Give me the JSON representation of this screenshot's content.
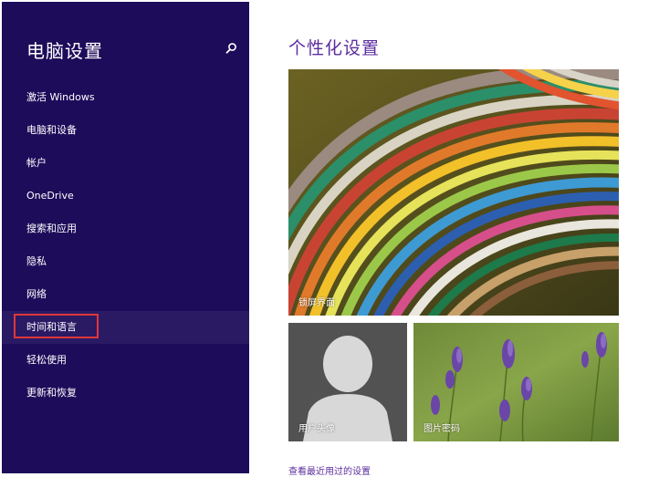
{
  "sidebar": {
    "title": "电脑设置",
    "search_icon": "search-icon",
    "items": [
      {
        "label": "激活 Windows"
      },
      {
        "label": "电脑和设备"
      },
      {
        "label": "帐户"
      },
      {
        "label": "OneDrive"
      },
      {
        "label": "搜索和应用"
      },
      {
        "label": "隐私"
      },
      {
        "label": "网络"
      },
      {
        "label": "时间和语言",
        "selected": true
      },
      {
        "label": "轻松使用"
      },
      {
        "label": "更新和恢复"
      }
    ]
  },
  "main": {
    "title": "个性化设置",
    "tiles": {
      "lock_screen": {
        "label": "锁屏界面"
      },
      "account_picture": {
        "label": "用户头像"
      },
      "picture_password": {
        "label": "图片密码"
      }
    },
    "recent_link": "查看最近用过的设置"
  },
  "colors": {
    "sidebar_bg": "#1d0c5a",
    "selected_bg": "#2a1a64",
    "focus_border": "#e0363b",
    "accent_text": "#5b2d9e"
  }
}
